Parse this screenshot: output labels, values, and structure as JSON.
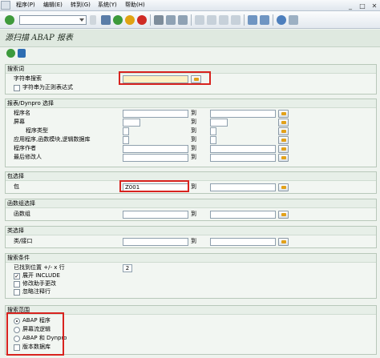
{
  "menu": {
    "items": [
      "程序(P)",
      "编辑(E)",
      "转到(G)",
      "系统(Y)",
      "帮助(H)"
    ]
  },
  "screen": {
    "title": "源扫描 ABAP 报表"
  },
  "groups": {
    "search_terms": {
      "title": "搜索词",
      "string_label": "字符串搜索",
      "string_value": "",
      "regex_label": "字符串为正则表达式"
    },
    "report_dynpro": {
      "title": "报表/Dynpro 选择",
      "to": "到",
      "rows": [
        "程序名",
        "屏幕",
        "程序类型",
        "应用程序,函数模块,逻辑数据库",
        "程序作者",
        "最后修改人"
      ]
    },
    "package": {
      "title": "包选择",
      "label": "包",
      "value": "Z001",
      "to": "到"
    },
    "function_group": {
      "title": "函数组选择",
      "label": "函数组",
      "to": "到"
    },
    "class": {
      "title": "类选择",
      "label": "类/接口",
      "to": "到"
    },
    "search_conditions": {
      "title": "搜索条件",
      "lines_label": "已找到位置 +/- x 行",
      "lines_value": "2",
      "expand_include": "展开 INCLUDE",
      "modification_asst": "修改助手更改",
      "ignore_comments": "忽略注释行"
    },
    "search_scope": {
      "title": "搜索范围",
      "options": [
        "ABAP 程序",
        "屏幕流逻辑",
        "ABAP 和 Dynpro"
      ],
      "selected": 0,
      "version_db": "版本数据库"
    }
  },
  "colors": {
    "highlight": "#d8231f",
    "background": "#eef3ee",
    "required_field": "#fcf0c4"
  }
}
